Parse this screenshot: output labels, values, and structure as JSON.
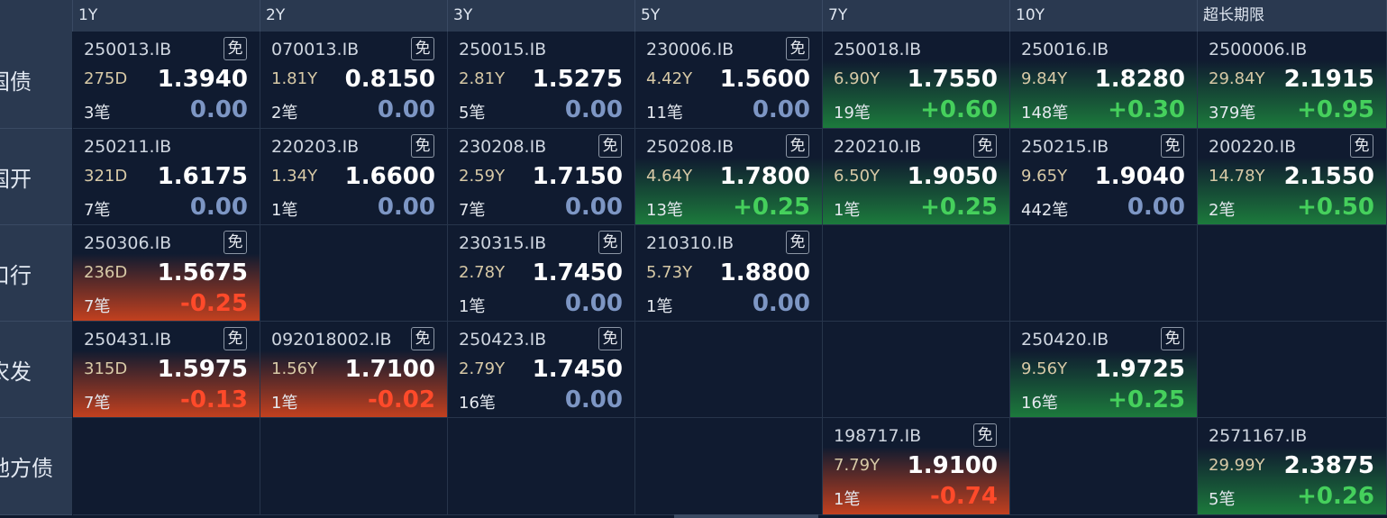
{
  "columns": [
    "1Y",
    "2Y",
    "3Y",
    "5Y",
    "7Y",
    "10Y",
    "超长期限"
  ],
  "rows": [
    {
      "label": "国债",
      "cells": [
        {
          "code": "250013.IB",
          "free": true,
          "term": "275D",
          "yield": "1.3940",
          "count": "3笔",
          "change": "0.00",
          "trend": "zero"
        },
        {
          "code": "070013.IB",
          "free": true,
          "term": "1.81Y",
          "yield": "0.8150",
          "count": "2笔",
          "change": "0.00",
          "trend": "zero"
        },
        {
          "code": "250015.IB",
          "free": false,
          "term": "2.81Y",
          "yield": "1.5275",
          "count": "5笔",
          "change": "0.00",
          "trend": "zero"
        },
        {
          "code": "230006.IB",
          "free": true,
          "term": "4.42Y",
          "yield": "1.5600",
          "count": "11笔",
          "change": "0.00",
          "trend": "zero"
        },
        {
          "code": "250018.IB",
          "free": false,
          "term": "6.90Y",
          "yield": "1.7550",
          "count": "19笔",
          "change": "+0.60",
          "trend": "pos"
        },
        {
          "code": "250016.IB",
          "free": false,
          "term": "9.84Y",
          "yield": "1.8280",
          "count": "148笔",
          "change": "+0.30",
          "trend": "pos"
        },
        {
          "code": "2500006.IB",
          "free": false,
          "term": "29.84Y",
          "yield": "2.1915",
          "count": "379笔",
          "change": "+0.95",
          "trend": "pos"
        }
      ]
    },
    {
      "label": "国开",
      "cells": [
        {
          "code": "250211.IB",
          "free": false,
          "term": "321D",
          "yield": "1.6175",
          "count": "7笔",
          "change": "0.00",
          "trend": "zero"
        },
        {
          "code": "220203.IB",
          "free": true,
          "term": "1.34Y",
          "yield": "1.6600",
          "count": "1笔",
          "change": "0.00",
          "trend": "zero"
        },
        {
          "code": "230208.IB",
          "free": true,
          "term": "2.59Y",
          "yield": "1.7150",
          "count": "7笔",
          "change": "0.00",
          "trend": "zero"
        },
        {
          "code": "250208.IB",
          "free": true,
          "term": "4.64Y",
          "yield": "1.7800",
          "count": "13笔",
          "change": "+0.25",
          "trend": "pos"
        },
        {
          "code": "220210.IB",
          "free": true,
          "term": "6.50Y",
          "yield": "1.9050",
          "count": "1笔",
          "change": "+0.25",
          "trend": "pos"
        },
        {
          "code": "250215.IB",
          "free": true,
          "term": "9.65Y",
          "yield": "1.9040",
          "count": "442笔",
          "change": "0.00",
          "trend": "zero"
        },
        {
          "code": "200220.IB",
          "free": true,
          "term": "14.78Y",
          "yield": "2.1550",
          "count": "2笔",
          "change": "+0.50",
          "trend": "pos"
        }
      ]
    },
    {
      "label": "口行",
      "cells": [
        {
          "code": "250306.IB",
          "free": true,
          "term": "236D",
          "yield": "1.5675",
          "count": "7笔",
          "change": "-0.25",
          "trend": "neg"
        },
        null,
        {
          "code": "230315.IB",
          "free": true,
          "term": "2.78Y",
          "yield": "1.7450",
          "count": "1笔",
          "change": "0.00",
          "trend": "zero"
        },
        {
          "code": "210310.IB",
          "free": true,
          "term": "5.73Y",
          "yield": "1.8800",
          "count": "1笔",
          "change": "0.00",
          "trend": "zero"
        },
        null,
        null,
        null
      ]
    },
    {
      "label": "农发",
      "cells": [
        {
          "code": "250431.IB",
          "free": true,
          "term": "315D",
          "yield": "1.5975",
          "count": "7笔",
          "change": "-0.13",
          "trend": "neg"
        },
        {
          "code": "092018002.IB",
          "free": true,
          "term": "1.56Y",
          "yield": "1.7100",
          "count": "1笔",
          "change": "-0.02",
          "trend": "neg"
        },
        {
          "code": "250423.IB",
          "free": true,
          "term": "2.79Y",
          "yield": "1.7450",
          "count": "16笔",
          "change": "0.00",
          "trend": "zero"
        },
        null,
        null,
        {
          "code": "250420.IB",
          "free": true,
          "term": "9.56Y",
          "yield": "1.9725",
          "count": "16笔",
          "change": "+0.25",
          "trend": "pos"
        },
        null
      ]
    },
    {
      "label": "地方债",
      "cells": [
        null,
        null,
        null,
        null,
        {
          "code": "198717.IB",
          "free": true,
          "term": "7.79Y",
          "yield": "1.9100",
          "count": "1笔",
          "change": "-0.74",
          "trend": "neg"
        },
        null,
        {
          "code": "2571167.IB",
          "free": false,
          "term": "29.99Y",
          "yield": "2.3875",
          "count": "5笔",
          "change": "+0.26",
          "trend": "pos"
        }
      ]
    }
  ],
  "free_badge": "免"
}
